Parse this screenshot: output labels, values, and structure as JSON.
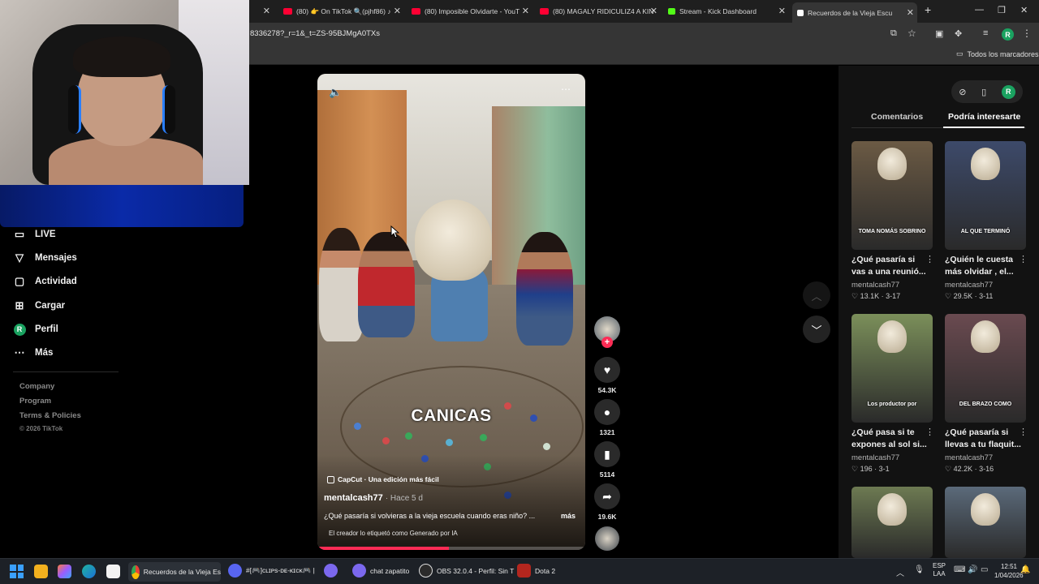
{
  "browser": {
    "tabs": [
      {
        "title": "(80) 👉 On TikTok 🔍(pjhf86) ♪",
        "fav_color": "#ff0033"
      },
      {
        "title": "(80) Imposible Olvidarte - YouT",
        "fav_color": "#ff0033"
      },
      {
        "title": "(80) MAGALY RIDICULIZ4 A KIN",
        "fav_color": "#ff0033"
      },
      {
        "title": "Stream - Kick Dashboard",
        "fav_color": "#53fc18"
      },
      {
        "title": "Recuerdos de la Vieja Escu",
        "fav_color": "#ffffff"
      }
    ],
    "partial_tab": "l",
    "url": "8336278?_r=1&_t=ZS-95BJMgA0TXs",
    "bookmarks_label": "Todos los marcadores",
    "profile_initial": "R"
  },
  "sidebar": {
    "items": [
      {
        "label": "LIVE",
        "icon": "live-icon"
      },
      {
        "label": "Mensajes",
        "icon": "messages-icon"
      },
      {
        "label": "Actividad",
        "icon": "activity-icon"
      },
      {
        "label": "Cargar",
        "icon": "upload-icon"
      },
      {
        "label": "Perfil",
        "icon": "profile-avatar"
      },
      {
        "label": "Más",
        "icon": "more-icon"
      }
    ],
    "avatar_initial": "R",
    "footer": [
      "Company",
      "Program",
      "Terms & Policies"
    ],
    "copyright": "© 2026 TikTok"
  },
  "video": {
    "overlay_title": "CANICAS",
    "capcut_label": "CapCut · Una edición más fácil",
    "author": "mentalcash77",
    "time": "· Hace 5 d",
    "description": "¿Qué pasaría si volvieras a la vieja escuela cuando eras niño? ...",
    "more": "más",
    "ai_label": "El creador lo etiquetó como Generado por IA",
    "progress": 0.49
  },
  "actions": {
    "likes": "54.3K",
    "comments": "1321",
    "saves": "5114",
    "shares": "19.6K"
  },
  "right_panel": {
    "tabs": [
      "Comentarios",
      "Podría interesarte"
    ],
    "cards": [
      {
        "caption": "TOMA NOMÁS SOBRINO",
        "title_1": "¿Qué pasaría si",
        "title_2": "vas a una reunió...",
        "author": "mentalcash77",
        "stats": "♡ 13.1K · 3-17",
        "bg": "#6b5a44"
      },
      {
        "caption": "AL QUE TERMINÓ",
        "title_1": "¿Quién le cuesta",
        "title_2": "más olvidar , el...",
        "author": "mentalcash77",
        "stats": "♡ 29.5K · 3-11",
        "bg": "#3d4a6a"
      },
      {
        "caption": "Los productor por",
        "title_1": "¿Qué pasa si te",
        "title_2": "expones al sol si...",
        "author": "mentalcash77",
        "stats": "♡ 196 · 3-1",
        "bg": "#7b8f5a"
      },
      {
        "caption": "DEL BRAZO COMO",
        "title_1": "¿Qué pasaría si",
        "title_2": "llevas a tu flaquit...",
        "author": "mentalcash77",
        "stats": "♡ 42.2K · 3-16",
        "bg": "#6a4a50"
      },
      {
        "caption": "",
        "title_1": "",
        "title_2": "",
        "author": "",
        "stats": "",
        "bg": "#6d7a52"
      },
      {
        "caption": "",
        "title_1": "",
        "title_2": "",
        "author": "",
        "stats": "",
        "bg": "#5b6a7a"
      }
    ]
  },
  "taskbar": {
    "apps": [
      {
        "label": "Recuerdos de la Vieja Es",
        "color": "#4285f4"
      },
      {
        "label": "#[🎮]ᴄʟɪᴘs-ᴅᴇ-ᴋɪᴄᴋ🎮 |",
        "color": "#5865f2"
      },
      {
        "label": "",
        "color": "#7b68ee"
      },
      {
        "label": "chat zapatito",
        "color": "#7b68ee"
      },
      {
        "label": "OBS 32.0.4 - Perfil: Sin T",
        "color": "#2b2b2b"
      },
      {
        "label": "Dota 2",
        "color": "#b3261e"
      }
    ],
    "lang_1": "ESP",
    "lang_2": "LAA",
    "time": "12:51",
    "date": "1/04/2026"
  }
}
